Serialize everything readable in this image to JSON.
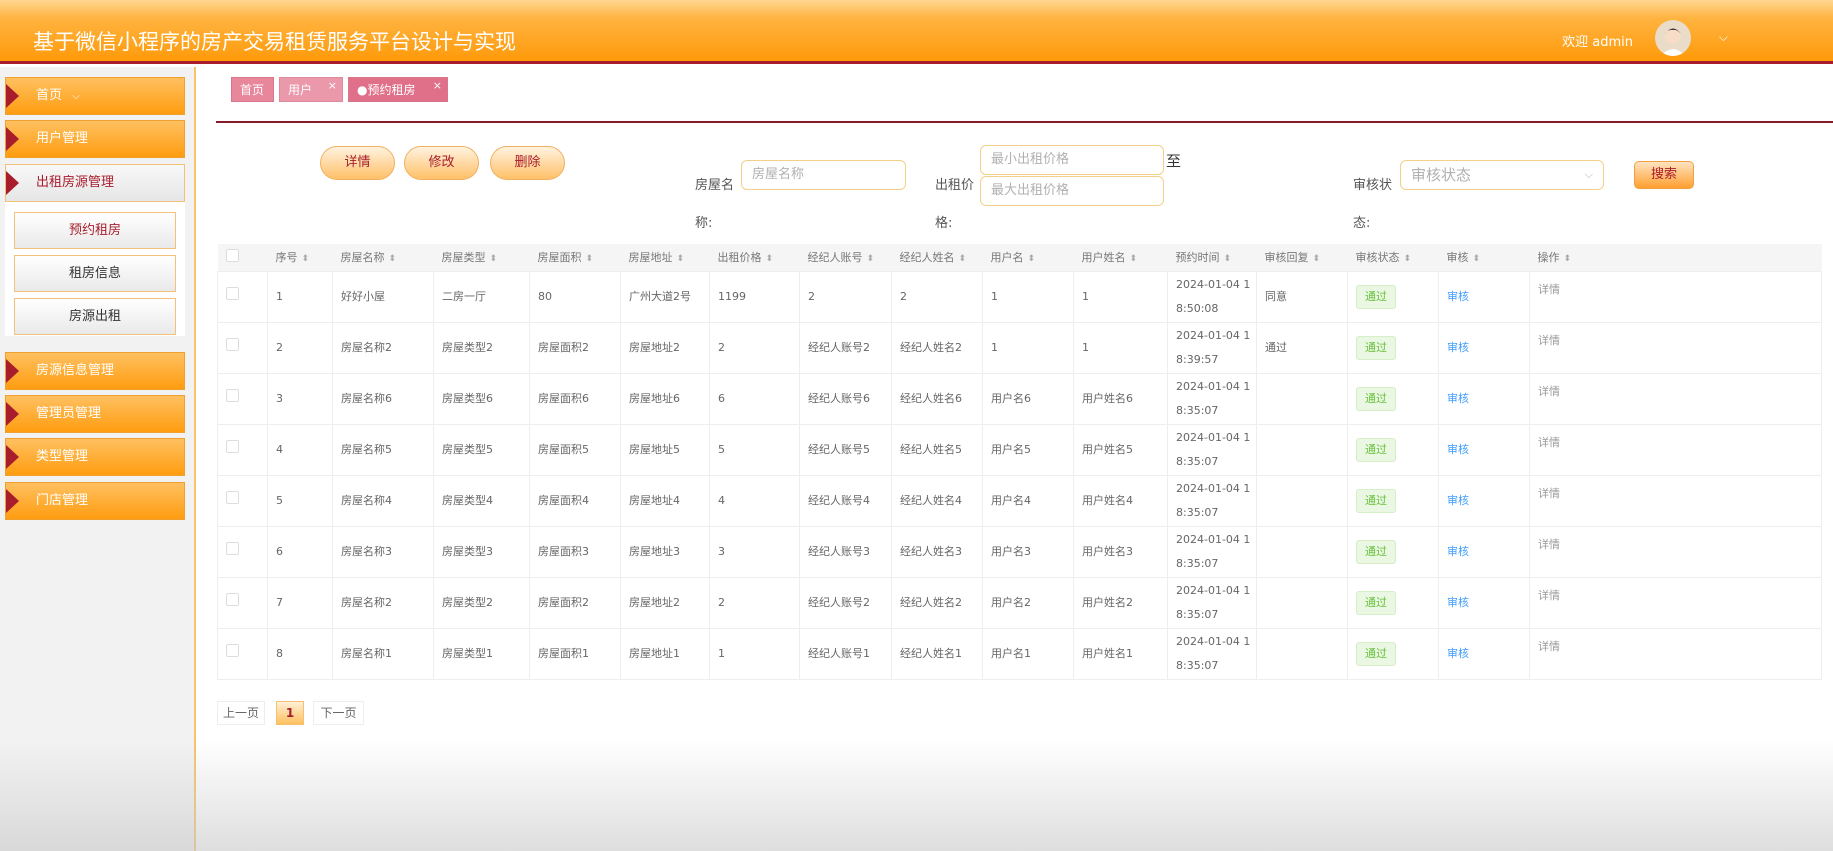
{
  "header": {
    "title": "基于微信小程序的房产交易租赁服务平台设计与实现",
    "welcome": "欢迎 admin"
  },
  "sidebar": {
    "items": [
      {
        "label": "首页"
      },
      {
        "label": "用户管理"
      },
      {
        "label": "出租房源管理"
      },
      {
        "label": "房源信息管理"
      },
      {
        "label": "管理员管理"
      },
      {
        "label": "类型管理"
      },
      {
        "label": "门店管理"
      }
    ],
    "sub_items": [
      {
        "label": "预约租房"
      },
      {
        "label": "租房信息"
      },
      {
        "label": "房源出租"
      }
    ]
  },
  "tabs": [
    {
      "label": "首页"
    },
    {
      "label": "用户"
    },
    {
      "label": "●预约租房"
    }
  ],
  "toolbar": {
    "detail": "详情",
    "edit": "修改",
    "delete": "删除"
  },
  "search": {
    "name_label": "房屋名称:",
    "name_placeholder": "房屋名称",
    "price_label": "出租价格:",
    "min_placeholder": "最小出租价格",
    "max_placeholder": "最大出租价格",
    "to": "至",
    "status_label": "审核状态:",
    "status_placeholder": "审核状态",
    "search_button": "搜索"
  },
  "table": {
    "headers": [
      "序号",
      "房屋名称",
      "房屋类型",
      "房屋面积",
      "房屋地址",
      "出租价格",
      "经纪人账号",
      "经纪人姓名",
      "用户名",
      "用户姓名",
      "预约时间",
      "审核回复",
      "审核状态",
      "审核",
      "操作"
    ],
    "rows": [
      [
        "1",
        "好好小屋",
        "二房一厅",
        "80",
        "广州大道2号",
        "1199",
        "2",
        "2",
        "1",
        "1",
        "2024-01-04 18:50:08",
        "同意",
        "通过",
        "审核",
        "详情"
      ],
      [
        "2",
        "房屋名称2",
        "房屋类型2",
        "房屋面积2",
        "房屋地址2",
        "2",
        "经纪人账号2",
        "经纪人姓名2",
        "1",
        "1",
        "2024-01-04 18:39:57",
        "通过",
        "通过",
        "审核",
        "详情"
      ],
      [
        "3",
        "房屋名称6",
        "房屋类型6",
        "房屋面积6",
        "房屋地址6",
        "6",
        "经纪人账号6",
        "经纪人姓名6",
        "用户名6",
        "用户姓名6",
        "2024-01-04 18:35:07",
        "",
        "通过",
        "审核",
        "详情"
      ],
      [
        "4",
        "房屋名称5",
        "房屋类型5",
        "房屋面积5",
        "房屋地址5",
        "5",
        "经纪人账号5",
        "经纪人姓名5",
        "用户名5",
        "用户姓名5",
        "2024-01-04 18:35:07",
        "",
        "通过",
        "审核",
        "详情"
      ],
      [
        "5",
        "房屋名称4",
        "房屋类型4",
        "房屋面积4",
        "房屋地址4",
        "4",
        "经纪人账号4",
        "经纪人姓名4",
        "用户名4",
        "用户姓名4",
        "2024-01-04 18:35:07",
        "",
        "通过",
        "审核",
        "详情"
      ],
      [
        "6",
        "房屋名称3",
        "房屋类型3",
        "房屋面积3",
        "房屋地址3",
        "3",
        "经纪人账号3",
        "经纪人姓名3",
        "用户名3",
        "用户姓名3",
        "2024-01-04 18:35:07",
        "",
        "通过",
        "审核",
        "详情"
      ],
      [
        "7",
        "房屋名称2",
        "房屋类型2",
        "房屋面积2",
        "房屋地址2",
        "2",
        "经纪人账号2",
        "经纪人姓名2",
        "用户名2",
        "用户姓名2",
        "2024-01-04 18:35:07",
        "",
        "通过",
        "审核",
        "详情"
      ],
      [
        "8",
        "房屋名称1",
        "房屋类型1",
        "房屋面积1",
        "房屋地址1",
        "1",
        "经纪人账号1",
        "经纪人姓名1",
        "用户名1",
        "用户姓名1",
        "2024-01-04 18:35:07",
        "",
        "通过",
        "审核",
        "详情"
      ]
    ]
  },
  "pagination": {
    "prev": "上一页",
    "current": "1",
    "next": "下一页"
  }
}
